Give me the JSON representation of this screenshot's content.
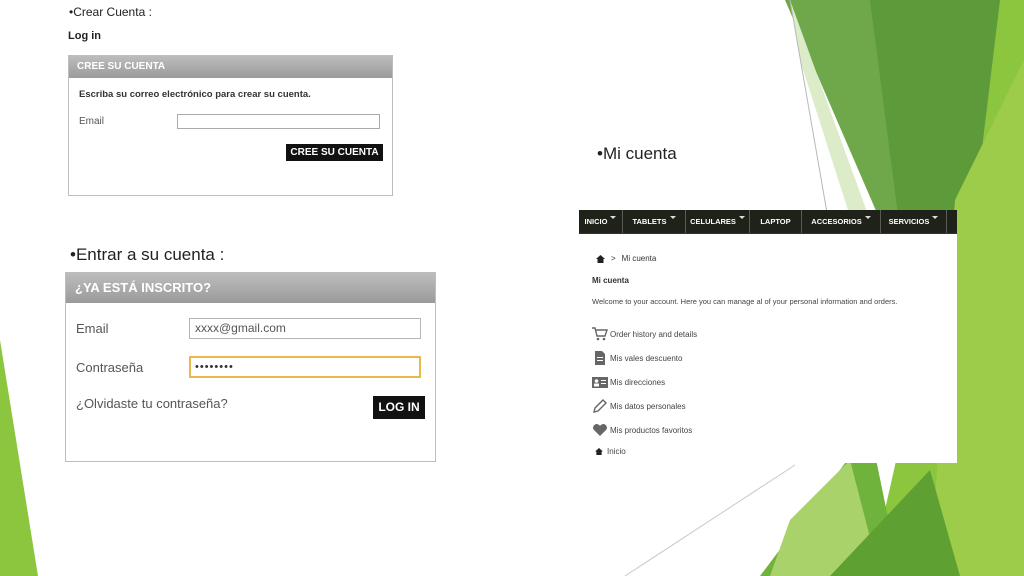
{
  "slide": {
    "bullet_crear": "•Crear Cuenta :",
    "login_label": "Log in",
    "bullet_entrar": "•Entrar a su cuenta :",
    "bullet_mi_cuenta": "•Mi cuenta"
  },
  "create_account": {
    "header": "CREE SU CUENTA",
    "description": "Escriba su correo electrónico para crear su cuenta.",
    "email_label": "Email",
    "email_value": "",
    "button": "CREE SU CUENTA"
  },
  "sign_in": {
    "header": "¿YA ESTÁ INSCRITO?",
    "email_label": "Email",
    "email_value": "xxxx@gmail.com",
    "password_label": "Contraseña",
    "password_value": "••••••••",
    "forgot": "¿Olvidaste tu contraseña?",
    "button": "LOG IN"
  },
  "my_account": {
    "nav": [
      {
        "label": "INICIO",
        "caret": true
      },
      {
        "label": "TABLETS",
        "caret": true
      },
      {
        "label": "CELULARES",
        "caret": true
      },
      {
        "label": "LAPTOP",
        "caret": false
      },
      {
        "label": "ACCESORIOS",
        "caret": true
      },
      {
        "label": "SERVICIOS",
        "caret": true
      }
    ],
    "breadcrumb_sep": ">",
    "breadcrumb_current": "Mi cuenta",
    "title": "Mi cuenta",
    "welcome": "Welcome to your account. Here you can manage al of your personal information and orders.",
    "menu": [
      {
        "icon": "cart-icon",
        "label": "Order history and details"
      },
      {
        "icon": "document-icon",
        "label": "Mis vales descuento"
      },
      {
        "icon": "address-card-icon",
        "label": "Mis direcciones"
      },
      {
        "icon": "pencil-icon",
        "label": "Mis datos personales"
      },
      {
        "icon": "heart-icon",
        "label": "Mis productos favoritos"
      }
    ],
    "home_link": "Inicio"
  },
  "colors": {
    "panel_header": "#a8a8a8",
    "nav_bg": "#1e2219",
    "green_dark": "#5d9a3a",
    "green_light": "#8cc63f",
    "password_focus": "#e8b94a"
  }
}
